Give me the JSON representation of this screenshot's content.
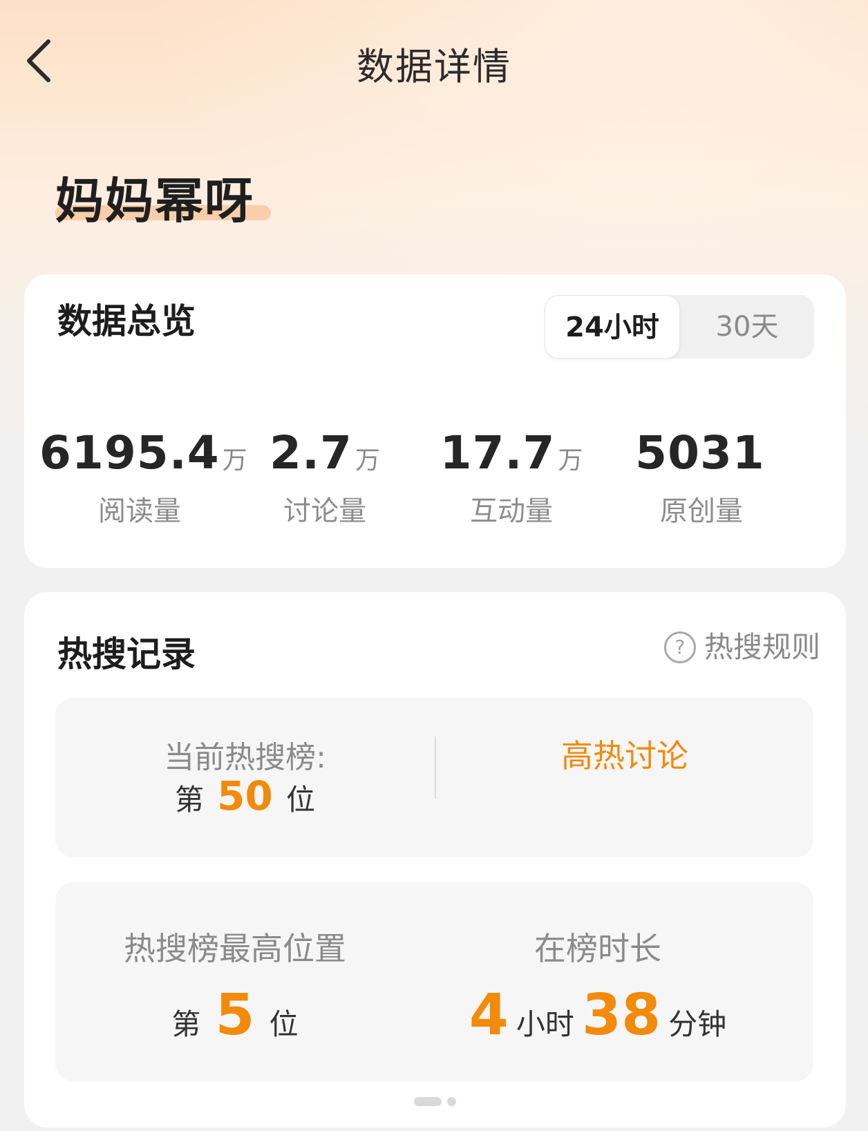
{
  "header": {
    "title": "数据详情",
    "back_icon": "chevron-left-icon"
  },
  "topic": {
    "title": "妈妈幂呀"
  },
  "overview": {
    "title": "数据总览",
    "tabs": [
      {
        "label": "24小时",
        "selected": true
      },
      {
        "label": "30天",
        "selected": false
      }
    ],
    "stats": [
      {
        "value": "6195.4",
        "unit": "万",
        "label": "阅读量"
      },
      {
        "value": "2.7",
        "unit": "万",
        "label": "讨论量"
      },
      {
        "value": "17.7",
        "unit": "万",
        "label": "互动量"
      },
      {
        "value": "5031",
        "unit": "",
        "label": "原创量"
      }
    ]
  },
  "hot_search": {
    "title": "热搜记录",
    "rules_label": "热搜规则",
    "help_icon": "question-circle-icon",
    "current": {
      "label": "当前热搜榜:",
      "prefix": "第",
      "rank": "50",
      "suffix": "位",
      "tag": "高热讨论"
    },
    "highest": {
      "label": "热搜榜最高位置",
      "prefix": "第",
      "rank": "5",
      "suffix": "位"
    },
    "duration": {
      "label": "在榜时长",
      "hours": "4",
      "hours_unit": "小时",
      "minutes": "38",
      "minutes_unit": "分钟"
    },
    "pager": {
      "pages": 2,
      "current": 1
    }
  },
  "colors": {
    "accent": "#f28a0b",
    "title_highlight": "#f7c9a0",
    "gradient_top": "#fde0c6",
    "page_bg": "#f1f1f1"
  }
}
